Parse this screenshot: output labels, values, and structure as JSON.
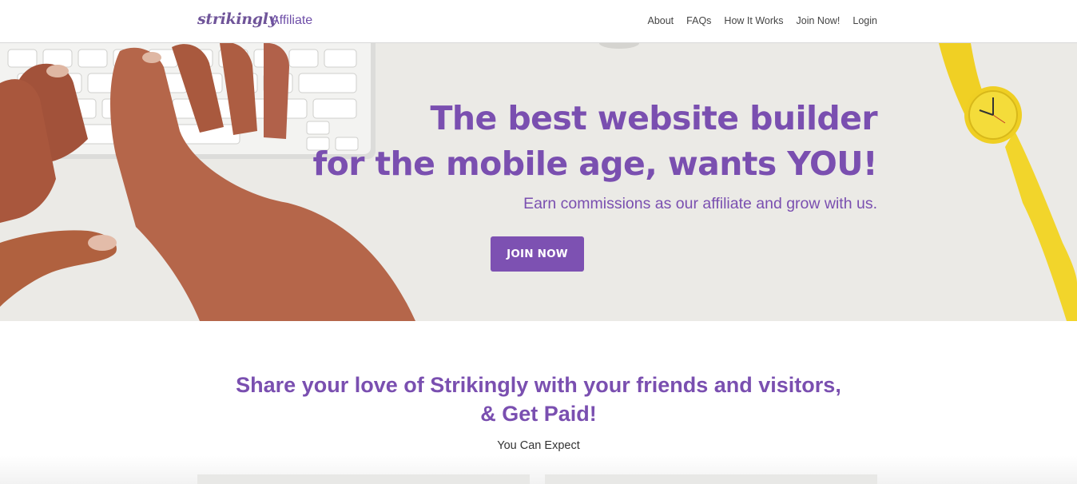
{
  "header": {
    "logo": "strikingly",
    "logo_sub": "Affiliate",
    "nav": [
      {
        "label": "About"
      },
      {
        "label": "FAQs"
      },
      {
        "label": "How It Works"
      },
      {
        "label": "Join Now!"
      },
      {
        "label": "Login"
      }
    ]
  },
  "hero": {
    "title_line1": "The best website builder",
    "title_line2": "for the mobile age, wants YOU!",
    "subtitle": "Earn commissions as our affiliate and grow with us.",
    "button_label": "JOIN NOW"
  },
  "section": {
    "title_line1": "Share your love of Strikingly with your friends and visitors,",
    "title_line2": "& Get Paid!",
    "expect_label": "You Can Expect"
  },
  "colors": {
    "brand_purple": "#7a4fb0",
    "button_purple": "#7d51b2",
    "hero_background": "#eae9e5",
    "watch_yellow": "#f2d52b"
  }
}
